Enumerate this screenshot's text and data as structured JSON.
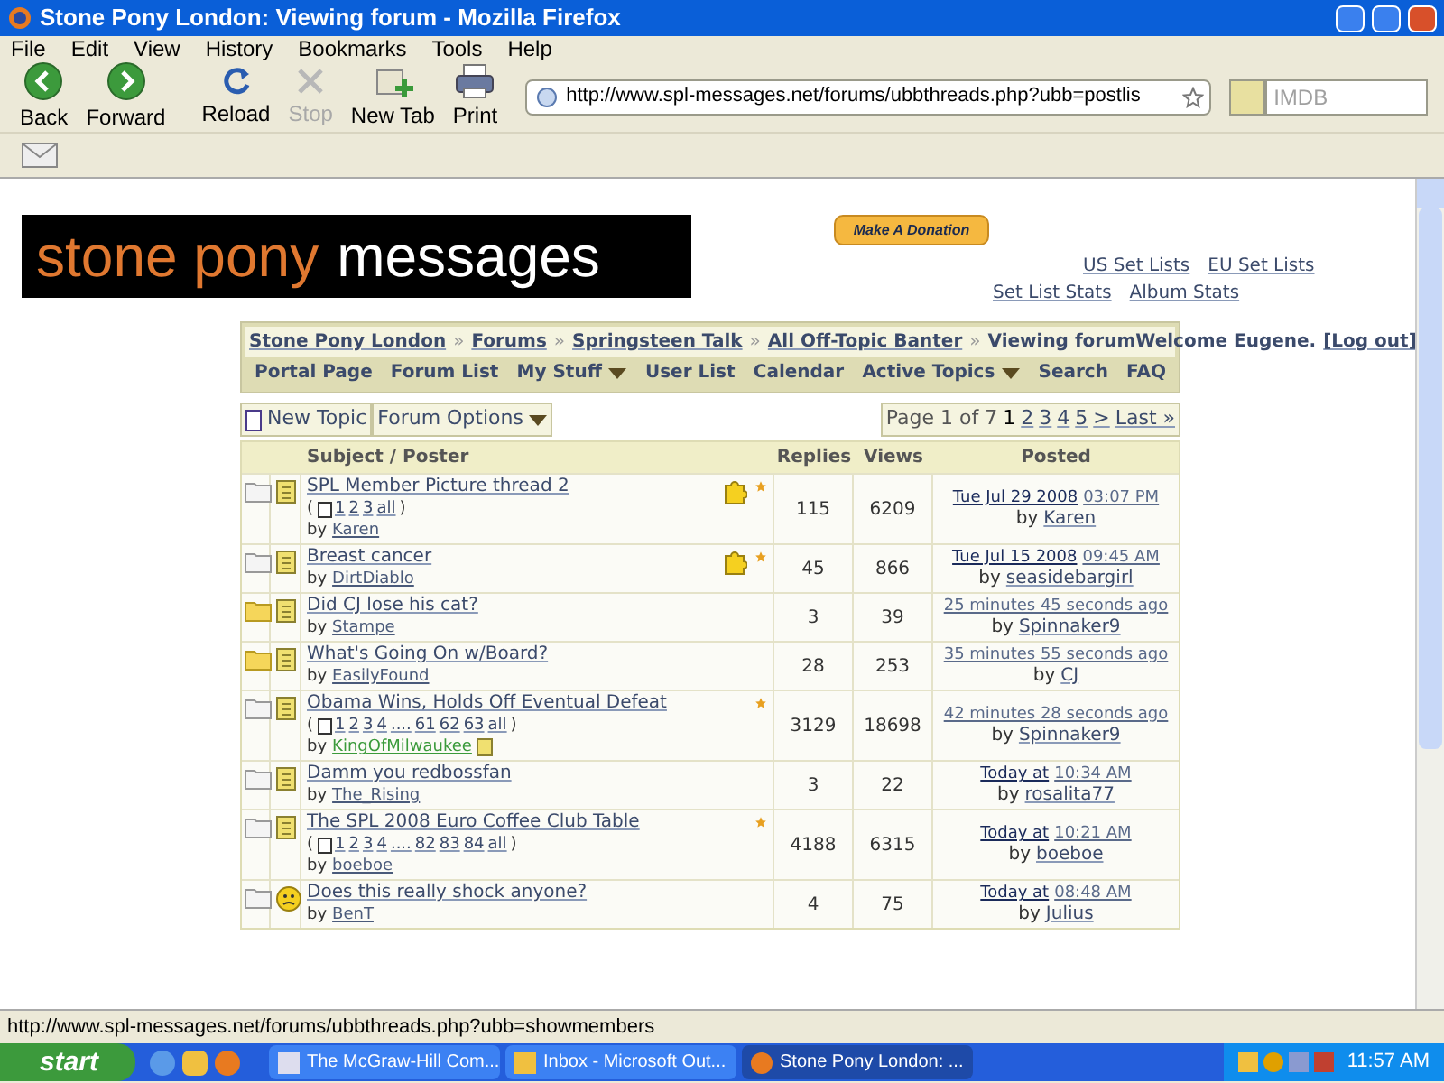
{
  "window": {
    "title": "Stone Pony London: Viewing forum - Mozilla Firefox"
  },
  "menu": [
    "File",
    "Edit",
    "View",
    "History",
    "Bookmarks",
    "Tools",
    "Help"
  ],
  "toolbar": [
    {
      "label": "Back",
      "kind": "back",
      "disabled": false
    },
    {
      "label": "Forward",
      "kind": "forward",
      "disabled": false
    },
    {
      "label": "Reload",
      "kind": "reload",
      "disabled": false
    },
    {
      "label": "Stop",
      "kind": "stop",
      "disabled": true
    },
    {
      "label": "New Tab",
      "kind": "newtab",
      "disabled": false
    },
    {
      "label": "Print",
      "kind": "print",
      "disabled": false
    }
  ],
  "address": {
    "value": "http://www.spl-messages.net/forums/ubbthreads.php?ubb=postlis"
  },
  "search": {
    "placeholder": "IMDB"
  },
  "page": {
    "logo": {
      "first": "stone pony",
      "second": "messages"
    },
    "donate": "Make A Donation",
    "links_row1": [
      "US Set Lists",
      "EU Set Lists"
    ],
    "links_row2": [
      "Set List Stats",
      "Album Stats"
    ],
    "breadcrumb": {
      "links": [
        "Stone Pony London",
        "Forums",
        "Springsteen Talk",
        "All Off-Topic Banter"
      ],
      "separator": "»",
      "current": "Viewing forum",
      "welcome": "Welcome Eugene.",
      "logout": "[Log out]"
    },
    "nav": [
      {
        "label": "Portal Page",
        "dropdown": false
      },
      {
        "label": "Forum List",
        "dropdown": false
      },
      {
        "label": "My Stuff",
        "dropdown": true
      },
      {
        "label": "User List",
        "dropdown": false
      },
      {
        "label": "Calendar",
        "dropdown": false
      },
      {
        "label": "Active Topics",
        "dropdown": true
      },
      {
        "label": "Search",
        "dropdown": false
      },
      {
        "label": "FAQ",
        "dropdown": false
      }
    ],
    "actions": [
      {
        "label": "New Topic",
        "kind": "newtopic"
      },
      {
        "label": "Forum Options",
        "kind": "dropdown"
      }
    ],
    "pager": {
      "label": "Page 1 of 7",
      "pages": [
        {
          "label": "1",
          "selected": true
        },
        {
          "label": "2",
          "selected": false
        },
        {
          "label": "3",
          "selected": false
        },
        {
          "label": "4",
          "selected": false
        },
        {
          "label": "5",
          "selected": false
        },
        {
          "label": ">",
          "selected": false
        },
        {
          "label": "Last »",
          "selected": false
        }
      ]
    },
    "table": {
      "columns": [
        "Subject / Poster",
        "Replies",
        "Views",
        "Posted"
      ],
      "rows": [
        {
          "unread": false,
          "kind": "note",
          "sticky": true,
          "popular": true,
          "title": "SPL Member Picture thread 2",
          "pages": {
            "open": "(",
            "items": [
              "1",
              "2",
              "3",
              "all"
            ],
            "close": ")"
          },
          "by": "by",
          "poster": "Karen",
          "color": "#4a5a7a",
          "poster_badge": false,
          "replies": "115",
          "views": "6209",
          "posted_date": "Tue Jul 29 2008",
          "posted_time": "03:07 PM",
          "posted_by_label": "by",
          "posted_by": "Karen"
        },
        {
          "unread": false,
          "kind": "note",
          "sticky": true,
          "popular": true,
          "title": "Breast cancer",
          "by": "by",
          "poster": "DirtDiablo",
          "color": "#4a5a7a",
          "poster_badge": false,
          "replies": "45",
          "views": "866",
          "posted_date": "Tue Jul 15 2008",
          "posted_time": "09:45 AM",
          "posted_by_label": "by",
          "posted_by": "seasidebargirl"
        },
        {
          "unread": true,
          "kind": "note",
          "sticky": false,
          "popular": false,
          "title": "Did CJ lose his cat?",
          "by": "by",
          "poster": "Stampe",
          "color": "#4a5a7a",
          "poster_badge": false,
          "replies": "3",
          "views": "39",
          "posted_date": "25 minutes 45 seconds ago",
          "posted_by_label": "by",
          "posted_by": "Spinnaker9"
        },
        {
          "unread": true,
          "kind": "note",
          "sticky": false,
          "popular": false,
          "title": "What's Going On w/Board?",
          "by": "by",
          "poster": "EasilyFound",
          "color": "#4a5a7a",
          "poster_badge": false,
          "replies": "28",
          "views": "253",
          "posted_date": "35 minutes 55 seconds ago",
          "posted_by_label": "by",
          "posted_by": "CJ"
        },
        {
          "unread": false,
          "kind": "note",
          "sticky": false,
          "popular": true,
          "title": "Obama Wins, Holds Off Eventual Defeat",
          "pages": {
            "open": "(",
            "items": [
              "1",
              "2",
              "3",
              "4",
              "....",
              "61",
              "62",
              "63",
              "all"
            ],
            "close": ")"
          },
          "by": "by",
          "poster": "KingOfMilwaukee",
          "color": "#3a9a3a",
          "poster_badge": true,
          "replies": "3129",
          "views": "18698",
          "posted_date": "42 minutes 28 seconds ago",
          "posted_by_label": "by",
          "posted_by": "Spinnaker9"
        },
        {
          "unread": false,
          "kind": "note",
          "sticky": false,
          "popular": false,
          "title": "Damm you redbossfan",
          "by": "by",
          "poster": "The_Rising",
          "color": "#4a5a7a",
          "poster_badge": false,
          "replies": "3",
          "views": "22",
          "posted_date": "Today at",
          "posted_time": "10:34 AM",
          "posted_by_label": "by",
          "posted_by": "rosalita77"
        },
        {
          "unread": false,
          "kind": "note",
          "sticky": false,
          "popular": true,
          "title": "The SPL 2008 Euro Coffee Club Table",
          "pages": {
            "open": "(",
            "items": [
              "1",
              "2",
              "3",
              "4",
              "....",
              "82",
              "83",
              "84",
              "all"
            ],
            "close": ")"
          },
          "by": "by",
          "poster": "boeboe",
          "color": "#4a5a7a",
          "poster_badge": false,
          "replies": "4188",
          "views": "6315",
          "posted_date": "Today at",
          "posted_time": "10:21 AM",
          "posted_by_label": "by",
          "posted_by": "boeboe"
        },
        {
          "unread": false,
          "kind": "frown",
          "sticky": false,
          "popular": false,
          "title": "Does this really shock anyone?",
          "by": "by",
          "poster": "BenT",
          "color": "#4a5a7a",
          "poster_badge": false,
          "replies": "4",
          "views": "75",
          "posted_date": "Today at",
          "posted_time": "08:48 AM",
          "posted_by_label": "by",
          "posted_by": "Julius"
        }
      ]
    }
  },
  "status_bar": {
    "text": "http://www.spl-messages.net/forums/ubbthreads.php?ubb=showmembers"
  },
  "taskbar": {
    "start": "start",
    "tasks": [
      {
        "label": "The McGraw-Hill Com...",
        "kind": "doc",
        "selected": false
      },
      {
        "label": "Inbox - Microsoft Out...",
        "kind": "mail",
        "selected": false
      },
      {
        "label": "Stone Pony London: ...",
        "kind": "firefox",
        "selected": true
      }
    ],
    "clock": "11:57 AM"
  }
}
